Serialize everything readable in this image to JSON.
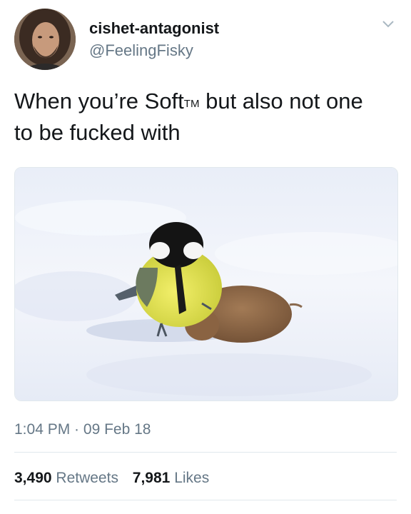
{
  "user": {
    "display_name": "cishet-antagonist",
    "handle": "@FeelingFisky"
  },
  "tweet": {
    "text_before": "When you’re Soft",
    "trademark": "TM",
    "text_after": " but also not one to be fucked with"
  },
  "meta": {
    "time": "1:04 PM",
    "separator": " · ",
    "date": "09 Feb 18"
  },
  "stats": {
    "retweets_count": "3,490",
    "retweets_label": "Retweets",
    "likes_count": "7,981",
    "likes_label": "Likes"
  },
  "icons": {
    "menu": "chevron-down-icon"
  },
  "colors": {
    "text": "#14171a",
    "secondary": "#657786",
    "divider": "#e1e8ed",
    "chevron": "#aab8c2"
  }
}
